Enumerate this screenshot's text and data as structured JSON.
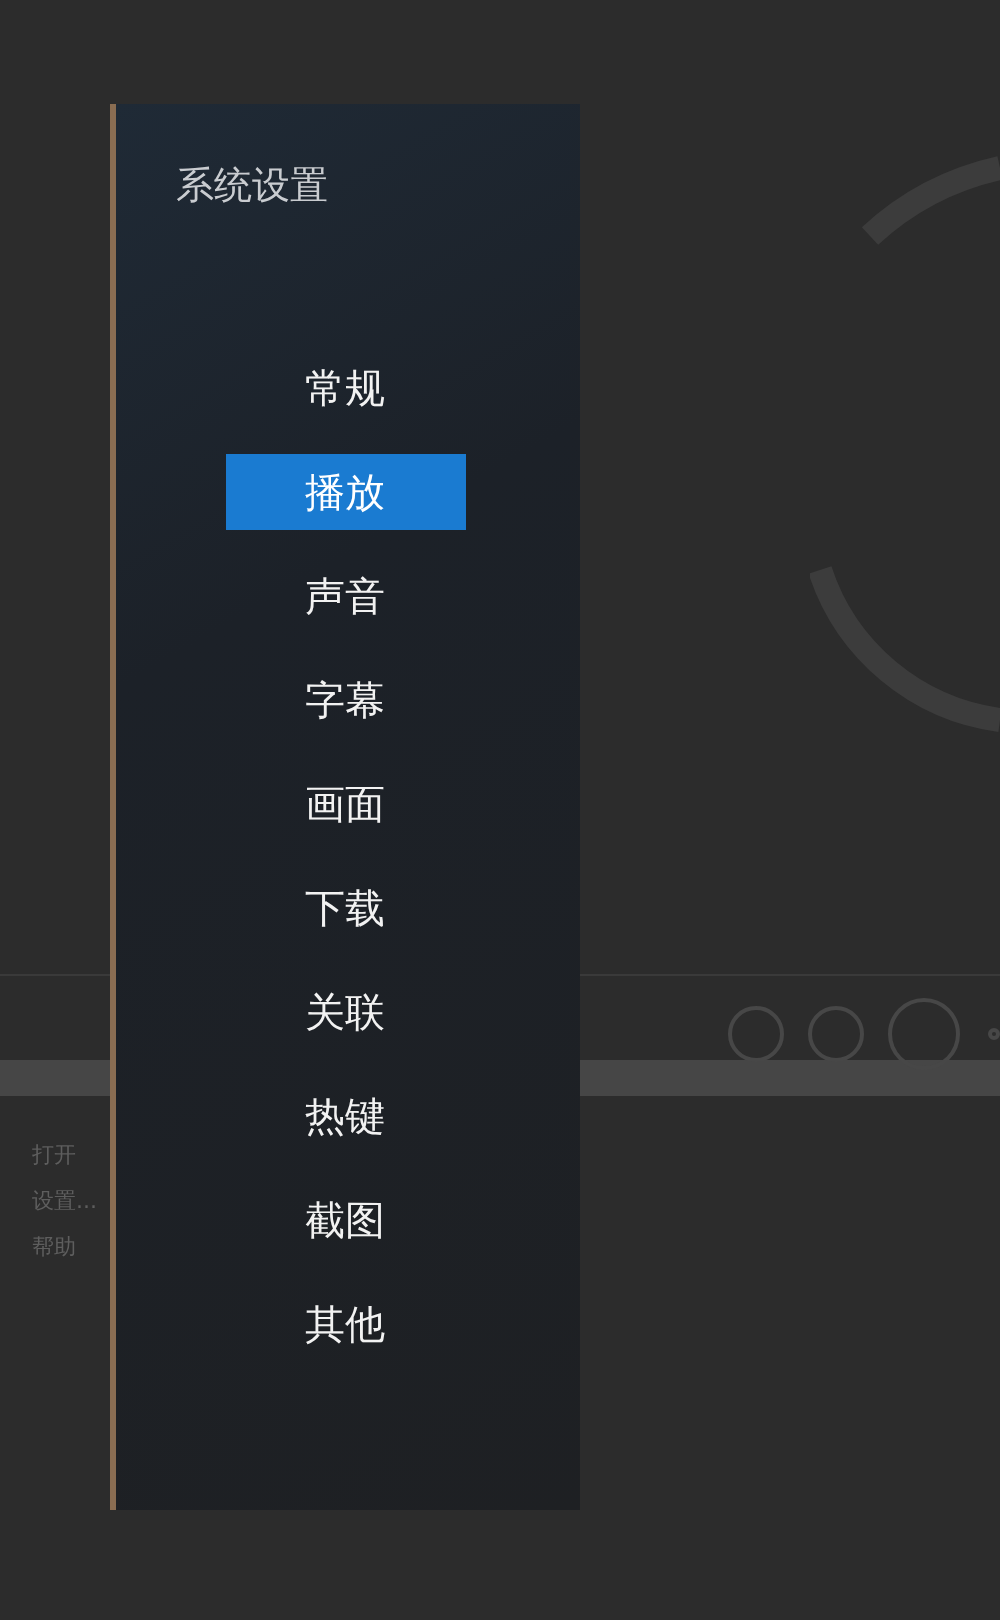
{
  "backdrop": {
    "menu_items": [
      "打开",
      "设置...",
      "帮助"
    ]
  },
  "settings": {
    "title": "系统设置",
    "items": [
      {
        "label": "常规",
        "selected": false
      },
      {
        "label": "播放",
        "selected": true
      },
      {
        "label": "声音",
        "selected": false
      },
      {
        "label": "字幕",
        "selected": false
      },
      {
        "label": "画面",
        "selected": false
      },
      {
        "label": "下载",
        "selected": false
      },
      {
        "label": "关联",
        "selected": false
      },
      {
        "label": "热键",
        "selected": false
      },
      {
        "label": "截图",
        "selected": false
      },
      {
        "label": "其他",
        "selected": false
      }
    ]
  }
}
